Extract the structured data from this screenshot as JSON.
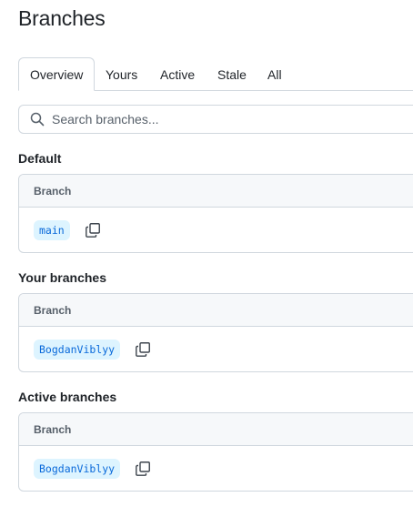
{
  "page": {
    "title": "Branches"
  },
  "tabs": [
    {
      "label": "Overview",
      "selected": true
    },
    {
      "label": "Yours",
      "selected": false
    },
    {
      "label": "Active",
      "selected": false
    },
    {
      "label": "Stale",
      "selected": false
    },
    {
      "label": "All",
      "selected": false
    }
  ],
  "search": {
    "placeholder": "Search branches..."
  },
  "sections": {
    "default": {
      "title": "Default",
      "column_header": "Branch",
      "branch": "main"
    },
    "yours": {
      "title": "Your branches",
      "column_header": "Branch",
      "branch": "BogdanViblyy"
    },
    "active": {
      "title": "Active branches",
      "column_header": "Branch",
      "branch": "BogdanViblyy"
    }
  },
  "icons": {
    "search": "search-icon",
    "copy": "copy-icon"
  },
  "colors": {
    "branch_text": "#0969da",
    "branch_bg": "#ddf4ff",
    "border": "#d0d7de",
    "header_bg": "#f6f8fa"
  }
}
